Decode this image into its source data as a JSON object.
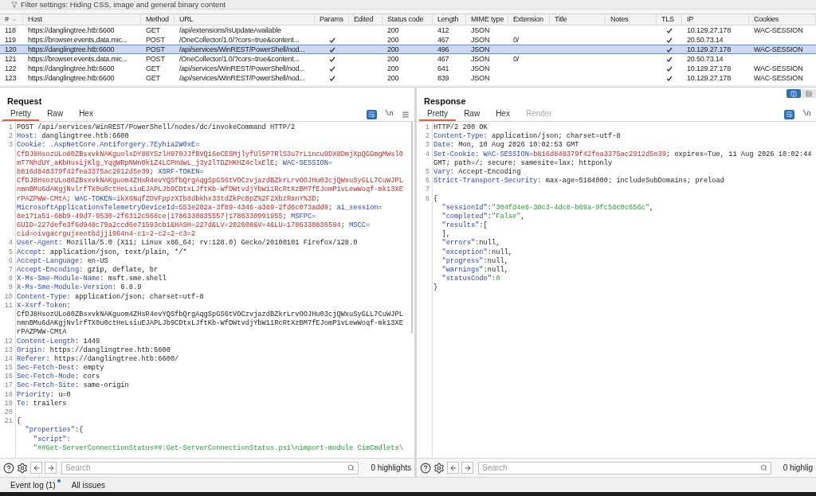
{
  "filter_bar": {
    "text": "Filter settings: Hiding CSS, image and general binary content"
  },
  "table": {
    "columns": [
      {
        "label": "#",
        "sorted": true
      },
      {
        "label": "Host",
        "sorted": false
      },
      {
        "label": "Method",
        "sorted": false
      },
      {
        "label": "URL",
        "sorted": false
      },
      {
        "label": "Params",
        "sorted": false
      },
      {
        "label": "Edited",
        "sorted": false
      },
      {
        "label": "Status code",
        "sorted": false
      },
      {
        "label": "Length",
        "sorted": false
      },
      {
        "label": "MIME type",
        "sorted": false
      },
      {
        "label": "Extension",
        "sorted": false
      },
      {
        "label": "Title",
        "sorted": false
      },
      {
        "label": "Notes",
        "sorted": false
      },
      {
        "label": "TLS",
        "sorted": false
      },
      {
        "label": "IP",
        "sorted": false
      },
      {
        "label": "Cookies",
        "sorted": false
      }
    ],
    "rows": [
      {
        "number": "118",
        "host": "https://danglingtree.htb:6600",
        "method": "GET",
        "url": "/api/extensions/isUpdateAvailable",
        "params": false,
        "status_code": "200",
        "length": "412",
        "mime_type": "JSON",
        "tls": true,
        "ip": "10.129.27.178",
        "cookies": "WAC-SESSION",
        "selected": false
      },
      {
        "number": "119",
        "host": "https://browser.events.data.mic...",
        "method": "POST",
        "url": "/OneCollector/1.0/?cors=true&content...",
        "params": true,
        "status_code": "200",
        "length": "467",
        "mime_type": "JSON",
        "extension": "0/",
        "tls": true,
        "ip": "20.50.73.14",
        "selected": false
      },
      {
        "number": "120",
        "host": "https://danglingtree.htb:6600",
        "method": "POST",
        "url": "/api/services/WinREST/PowerShell/nod...",
        "params": true,
        "status_code": "200",
        "length": "496",
        "mime_type": "JSON",
        "tls": true,
        "ip": "10.129.27.178",
        "cookies": "WAC-SESSION",
        "selected": true
      },
      {
        "number": "121",
        "host": "https://browser.events.data.mic...",
        "method": "POST",
        "url": "/OneCollector/1.0/?cors=true&content...",
        "params": true,
        "status_code": "200",
        "length": "467",
        "mime_type": "JSON",
        "extension": "0/",
        "tls": true,
        "ip": "20.50.73.14",
        "selected": false
      },
      {
        "number": "122",
        "host": "https://danglingtree.htb:6600",
        "method": "GET",
        "url": "/api/services/WinREST/PowerShell/nod...",
        "params": true,
        "status_code": "200",
        "length": "641",
        "mime_type": "JSON",
        "tls": true,
        "ip": "10.129.27.178",
        "cookies": "WAC-SESSION",
        "selected": false
      },
      {
        "number": "123",
        "host": "https://danglingtree.htb:6600",
        "method": "GET",
        "url": "/api/services/WinREST/PowerShell/nod...",
        "params": true,
        "status_code": "200",
        "length": "839",
        "mime_type": "JSON",
        "tls": true,
        "ip": "10.129.27.178",
        "cookies": "WAC-SESSION",
        "selected": false
      }
    ]
  },
  "request": {
    "title": "Request",
    "tabs": [
      {
        "label": "Pretty",
        "selected": true,
        "disabled": false
      },
      {
        "label": "Raw",
        "selected": false,
        "disabled": false
      },
      {
        "label": "Hex",
        "selected": false,
        "disabled": false
      }
    ],
    "newline_toggle": "\\n",
    "lines": [
      {
        "number": "1",
        "parts": [
          {
            "kind": "plain",
            "text": "POST /api/services/WinREST/PowerShell/nodes/dc/invokeCommand HTTP/2"
          }
        ]
      },
      {
        "number": "2",
        "parts": [
          {
            "kind": "key",
            "text": "Host"
          },
          {
            "kind": "plain",
            "text": ": danglingtree.htb:6600"
          }
        ]
      },
      {
        "number": "3",
        "parts": [
          {
            "kind": "key",
            "text": "Cookie"
          },
          {
            "kind": "plain",
            "text": ": "
          },
          {
            "kind": "key",
            "text": ".AspNetCore.Antiforgery.7Eyhia2W0xE="
          }
        ]
      },
      {
        "parts": [
          {
            "kind": "value",
            "text": "CfDJ8HsozULo80ZBsxvkNAKguolsDY88YSzlH970JJfBVQi6eCESMjlyfUl5P7RlS3u7rL1ncu9DX8DmjXpQGGmgMWsl0"
          }
        ]
      },
      {
        "parts": [
          {
            "kind": "value",
            "text": "mT7NhdUY_aKbHusijKlg_YqgWRpNWn0k1Z4LCPHdwL_j3y2lTDZHKHZ4clxElE"
          },
          {
            "kind": "plain",
            "text": "; "
          },
          {
            "kind": "key",
            "text": "WAC-SESSION="
          }
        ]
      },
      {
        "parts": [
          {
            "kind": "value",
            "text": "b816d848379f42fea3375ac2912d5e39"
          },
          {
            "kind": "plain",
            "text": "; "
          },
          {
            "kind": "key",
            "text": "XSRF-TOKEN="
          }
        ]
      },
      {
        "parts": [
          {
            "kind": "value",
            "text": "CfDJ8HsozULo80ZBsxvkNAKguom4ZHsR4evYQSfbQrgAqgSpGS6tVOCzvjazdBZkrLrvOOJHu03cjQWxuSyGLL7CuWJPL"
          }
        ]
      },
      {
        "parts": [
          {
            "kind": "value",
            "text": "nmnBMu6dAKgjNvlrfTX0u0ctHeLsiuEJAPLJb9CDtxLJftKb-WfDWtvdjYbW11RcRtXzBM7fEJomP1vLewWoqf-mk13XE"
          }
        ]
      },
      {
        "parts": [
          {
            "kind": "value",
            "text": "rPAZPWW-CMtA"
          },
          {
            "kind": "plain",
            "text": "; "
          },
          {
            "kind": "key",
            "text": "WAC-TOKEN="
          },
          {
            "kind": "value",
            "text": "ikX6NqfZOVFppzXIb8dbkhx33tdZkPcBpZ%2F2XbzRanY%3D"
          },
          {
            "kind": "plain",
            "text": ";"
          }
        ]
      },
      {
        "parts": [
          {
            "kind": "key",
            "text": "MicrosoftApplicationsTelemetryDeviceId="
          },
          {
            "kind": "value",
            "text": "553e202a-3f89-4346-a389-2fd6c073add9"
          },
          {
            "kind": "plain",
            "text": "; "
          },
          {
            "kind": "key",
            "text": "ai_session="
          }
        ]
      },
      {
        "parts": [
          {
            "kind": "value",
            "text": "8e171a51-68b9-49d7-9530-2f6312c568ce|1786330835557|1786330991955"
          },
          {
            "kind": "plain",
            "text": "; "
          },
          {
            "kind": "key",
            "text": "MSFPC="
          }
        ]
      },
      {
        "parts": [
          {
            "kind": "value",
            "text": "GUID=227defe3f6d948c79a2ccd6e71593cb1&HASH=227d&LV=202608&V=4&LU=1786330836594"
          },
          {
            "kind": "plain",
            "text": "; "
          },
          {
            "kind": "key",
            "text": "MSCC="
          }
        ]
      },
      {
        "parts": [
          {
            "kind": "value",
            "text": "cid=oivgacrgujxeotbdjji964n4-c1=2-c2=2-c3=2"
          }
        ]
      },
      {
        "number": "4",
        "parts": [
          {
            "kind": "key",
            "text": "User-Agent"
          },
          {
            "kind": "plain",
            "text": ": Mozilla/5.0 (X11; Linux x86_64; rv:128.0) Gecko/20100101 Firefox/128.0"
          }
        ]
      },
      {
        "number": "5",
        "parts": [
          {
            "kind": "key",
            "text": "Accept"
          },
          {
            "kind": "plain",
            "text": ": application/json, text/plain, */*"
          }
        ]
      },
      {
        "number": "6",
        "parts": [
          {
            "kind": "key",
            "text": "Accept-Language"
          },
          {
            "kind": "plain",
            "text": ": en-US"
          }
        ]
      },
      {
        "number": "7",
        "parts": [
          {
            "kind": "key",
            "text": "Accept-Encoding"
          },
          {
            "kind": "plain",
            "text": ": gzip, deflate, br"
          }
        ]
      },
      {
        "number": "8",
        "parts": [
          {
            "kind": "key",
            "text": "X-Ms-Sme-Module-Name"
          },
          {
            "kind": "plain",
            "text": ": msft.sme.shell"
          }
        ]
      },
      {
        "number": "9",
        "parts": [
          {
            "kind": "key",
            "text": "X-Ms-Sme-Module-Version"
          },
          {
            "kind": "plain",
            "text": ": 6.8.9"
          }
        ]
      },
      {
        "number": "10",
        "parts": [
          {
            "kind": "key",
            "text": "Content-Type"
          },
          {
            "kind": "plain",
            "text": ": application/json; charset=utf-8"
          }
        ]
      },
      {
        "number": "11",
        "parts": [
          {
            "kind": "key",
            "text": "X-Xsrf-Token"
          },
          {
            "kind": "plain",
            "text": ":"
          }
        ]
      },
      {
        "parts": [
          {
            "kind": "plain",
            "text": "CfDJ8HsozULo80ZBsxvkNAKguom4ZHsR4evYQSfbQrgAqgSpGS6tVOCzvjazdBZkrLrvOOJHu03cjQWxuSyGLL7CuWJPL"
          }
        ]
      },
      {
        "parts": [
          {
            "kind": "plain",
            "text": "nmnBMu6dAKgjNvlrfTX0u0ctHeLsiuEJAPLJb9CDtxLJftKb-WfDWtvdjYbW11RcRtXzBM7fEJomP1vLewWoqf-mk13XE"
          }
        ]
      },
      {
        "parts": [
          {
            "kind": "plain",
            "text": "rPAZPWW-CMtA"
          }
        ]
      },
      {
        "number": "12",
        "parts": [
          {
            "kind": "key",
            "text": "Content-Length"
          },
          {
            "kind": "plain",
            "text": ": 1449"
          }
        ]
      },
      {
        "number": "13",
        "parts": [
          {
            "kind": "key",
            "text": "Origin"
          },
          {
            "kind": "plain",
            "text": ": https://danglingtree.htb:6600"
          }
        ]
      },
      {
        "number": "14",
        "parts": [
          {
            "kind": "key",
            "text": "Referer"
          },
          {
            "kind": "plain",
            "text": ": https://danglingtree.htb:6600/"
          }
        ]
      },
      {
        "number": "15",
        "parts": [
          {
            "kind": "key",
            "text": "Sec-Fetch-Dest"
          },
          {
            "kind": "plain",
            "text": ": empty"
          }
        ]
      },
      {
        "number": "16",
        "parts": [
          {
            "kind": "key",
            "text": "Sec-Fetch-Mode"
          },
          {
            "kind": "plain",
            "text": ": cors"
          }
        ]
      },
      {
        "number": "17",
        "parts": [
          {
            "kind": "key",
            "text": "Sec-Fetch-Site"
          },
          {
            "kind": "plain",
            "text": ": same-origin"
          }
        ]
      },
      {
        "number": "18",
        "parts": [
          {
            "kind": "key",
            "text": "Priority"
          },
          {
            "kind": "plain",
            "text": ": u=0"
          }
        ]
      },
      {
        "number": "19",
        "parts": [
          {
            "kind": "key",
            "text": "Te"
          },
          {
            "kind": "plain",
            "text": ": trailers"
          }
        ]
      },
      {
        "number": "20"
      },
      {
        "number": "21",
        "parts": [
          {
            "kind": "plain",
            "text": "{"
          }
        ]
      },
      {
        "parts": [
          {
            "kind": "key",
            "text": "  \"properties\""
          },
          {
            "kind": "plain",
            "text": ":{"
          }
        ]
      },
      {
        "parts": [
          {
            "kind": "key",
            "text": "    \"script\""
          },
          {
            "kind": "plain",
            "text": ":"
          }
        ]
      },
      {
        "parts": [
          {
            "kind": "string",
            "text": "    \"##Get-ServerConnectionStatus##:Get-ServerConnectionStatus.ps1\\nimport-module CimCmdlets\\"
          }
        ]
      }
    ]
  },
  "response": {
    "title": "Response",
    "tabs": [
      {
        "label": "Pretty",
        "selected": true,
        "disabled": false
      },
      {
        "label": "Raw",
        "selected": false,
        "disabled": false
      },
      {
        "label": "Hex",
        "selected": false,
        "disabled": false
      },
      {
        "label": "Render",
        "selected": false,
        "disabled": true
      }
    ],
    "newline_toggle": "\\n",
    "layout_toggles": [
      {
        "kind": "split",
        "selected": true
      },
      {
        "kind": "list",
        "selected": false
      }
    ],
    "lines": [
      {
        "number": "1",
        "parts": [
          {
            "kind": "plain",
            "text": "HTTP/2 200 OK"
          }
        ]
      },
      {
        "number": "2",
        "parts": [
          {
            "kind": "key",
            "text": "Content-Type"
          },
          {
            "kind": "plain",
            "text": ": application/json; charset=utf-8"
          }
        ]
      },
      {
        "number": "3",
        "parts": [
          {
            "kind": "key",
            "text": "Date"
          },
          {
            "kind": "plain",
            "text": ": Mon, 10 Aug 2026 10:02:53 GMT"
          }
        ]
      },
      {
        "number": "4",
        "parts": [
          {
            "kind": "key",
            "text": "Set-Cookie"
          },
          {
            "kind": "plain",
            "text": ": "
          },
          {
            "kind": "key",
            "text": "WAC-SESSION="
          },
          {
            "kind": "value",
            "text": "b816d848379f42fea3375ac2912d5e39"
          },
          {
            "kind": "plain",
            "text": "; expires=Tue, 11 Aug 2026 10:02:44"
          }
        ]
      },
      {
        "parts": [
          {
            "kind": "plain",
            "text": "GMT; path=/; secure; samesite=lax; httponly"
          }
        ]
      },
      {
        "number": "5",
        "parts": [
          {
            "kind": "key",
            "text": "Vary"
          },
          {
            "kind": "plain",
            "text": ": Accept-Encoding"
          }
        ]
      },
      {
        "number": "6",
        "parts": [
          {
            "kind": "key",
            "text": "Strict-Transport-Security"
          },
          {
            "kind": "plain",
            "text": ": max-age=5184000; includeSubDomains; preload"
          }
        ]
      },
      {
        "number": "7"
      },
      {
        "number": "8",
        "parts": [
          {
            "kind": "plain",
            "text": "{"
          }
        ]
      },
      {
        "parts": [
          {
            "kind": "key",
            "text": "  \"sessionId\""
          },
          {
            "kind": "plain",
            "text": ":"
          },
          {
            "kind": "string",
            "text": "\"304fd4e8-30c3-4dc8-b69a-9fc58c0c656c\""
          },
          {
            "kind": "plain",
            "text": ","
          }
        ]
      },
      {
        "parts": [
          {
            "kind": "key",
            "text": "  \"completed\""
          },
          {
            "kind": "plain",
            "text": ":"
          },
          {
            "kind": "string",
            "text": "\"False\""
          },
          {
            "kind": "plain",
            "text": ","
          }
        ]
      },
      {
        "parts": [
          {
            "kind": "key",
            "text": "  \"results\""
          },
          {
            "kind": "plain",
            "text": ":["
          }
        ]
      },
      {
        "parts": [
          {
            "kind": "plain",
            "text": "  ],"
          }
        ]
      },
      {
        "parts": [
          {
            "kind": "key",
            "text": "  \"errors\""
          },
          {
            "kind": "plain",
            "text": ":null,"
          }
        ]
      },
      {
        "parts": [
          {
            "kind": "key",
            "text": "  \"exception\""
          },
          {
            "kind": "plain",
            "text": ":null,"
          }
        ]
      },
      {
        "parts": [
          {
            "kind": "key",
            "text": "  \"progress\""
          },
          {
            "kind": "plain",
            "text": ":null,"
          }
        ]
      },
      {
        "parts": [
          {
            "kind": "key",
            "text": "  \"warnings\""
          },
          {
            "kind": "plain",
            "text": ":null,"
          }
        ]
      },
      {
        "parts": [
          {
            "kind": "key",
            "text": "  \"statusCode\""
          },
          {
            "kind": "plain",
            "text": ":"
          },
          {
            "kind": "string",
            "text": "0"
          }
        ]
      },
      {
        "parts": [
          {
            "kind": "plain",
            "text": "}"
          }
        ]
      }
    ]
  },
  "request_search": {
    "placeholder": "Search",
    "highlights": "0 highlights"
  },
  "response_search": {
    "placeholder": "Search",
    "highlights": "0 highlig"
  },
  "status_bar": {
    "event_log": {
      "label": "Event log (1)",
      "unread": true
    },
    "all_issues": "All issues"
  }
}
